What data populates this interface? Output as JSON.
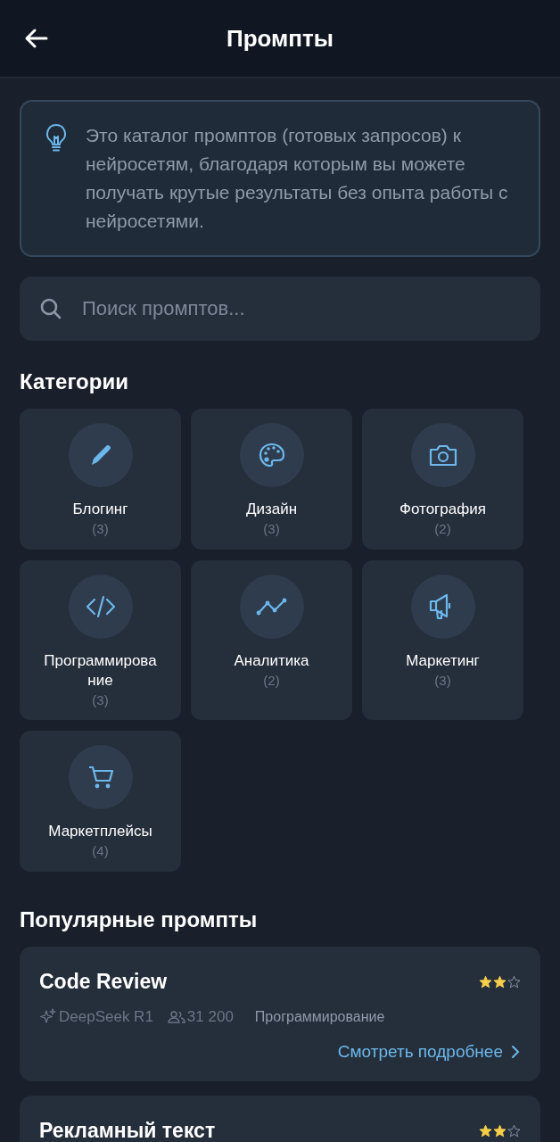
{
  "header": {
    "title": "Промпты"
  },
  "info": {
    "text": "Это каталог промптов (готовых запросов) к нейросетям, благодаря которым вы можете получать крутые результаты без опыта работы с нейросетями."
  },
  "search": {
    "placeholder": "Поиск промптов..."
  },
  "categories_title": "Категории",
  "categories": [
    {
      "kind": "pencil",
      "name": "Блогинг",
      "count": "(3)"
    },
    {
      "kind": "palette",
      "name": "Дизайн",
      "count": "(3)"
    },
    {
      "kind": "camera",
      "name": "Фотография",
      "count": "(2)"
    },
    {
      "kind": "code",
      "name": "Программирова ние",
      "count": "(3)"
    },
    {
      "kind": "chart",
      "name": "Аналитика",
      "count": "(2)"
    },
    {
      "kind": "megaphone",
      "name": "Маркетинг",
      "count": "(3)"
    },
    {
      "kind": "cart",
      "name": "Маркетплейсы",
      "count": "(4)"
    }
  ],
  "popular_title": "Популярные промпты",
  "prompts": [
    {
      "title": "Code Review",
      "stars": 2,
      "model": "DeepSeek R1",
      "users": "31 200",
      "category": "Программирование",
      "link": "Смотреть подробнее"
    },
    {
      "title": "Рекламный текст",
      "stars": 2
    }
  ]
}
